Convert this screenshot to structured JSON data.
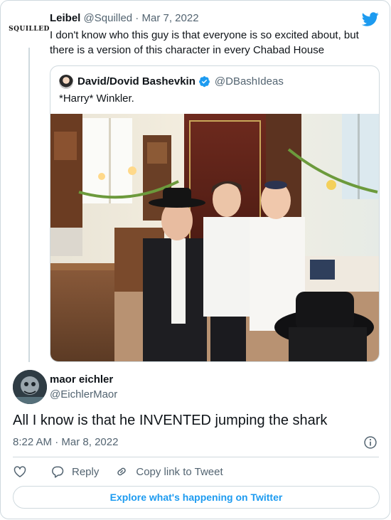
{
  "parent_tweet": {
    "avatar_text": "SQUILLED",
    "name": "Leibel",
    "handle": "@Squilled",
    "separator": " · ",
    "date": "Mar 7, 2022",
    "text": "I don't know who this guy is that everyone is so excited about, but there is a version of this character in every Chabad House"
  },
  "quoted_tweet": {
    "name": "David/Dovid Bashevkin",
    "handle": "@DBashIdeas",
    "text": "*Harry* Winkler."
  },
  "reply": {
    "name": "maor eichler",
    "handle": "@EichlerMaor",
    "text": "All I know is that he INVENTED jumping the shark",
    "time": "8:22 AM",
    "separator": " · ",
    "date": "Mar 8, 2022"
  },
  "actions": {
    "reply_label": "Reply",
    "copy_label": "Copy link to Tweet"
  },
  "explore_label": "Explore what's happening on Twitter",
  "colors": {
    "brand": "#1d9bf0",
    "text": "#0f1419",
    "muted": "#536471",
    "border": "#cfd9de"
  },
  "icons": [
    "twitter-bird-icon",
    "verified-badge-icon",
    "info-icon",
    "heart-icon",
    "reply-bubble-icon",
    "link-icon"
  ]
}
